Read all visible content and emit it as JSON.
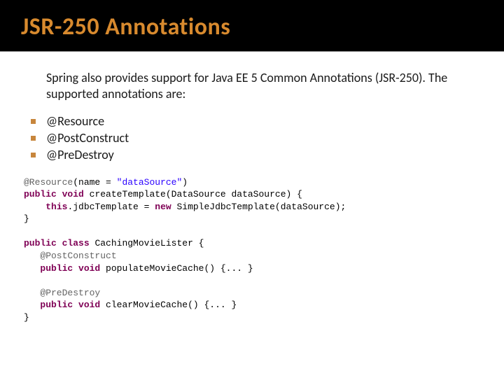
{
  "title": "JSR-250 Annotations",
  "intro": "Spring also provides support for Java EE 5 Common Annotations (JSR-250). The supported annotations are:",
  "bullets": [
    "@Resource",
    "@PostConstruct",
    "@PreDestroy"
  ],
  "code": {
    "t1": "@Resource",
    "t2": "(name = ",
    "t3": "\"dataSource\"",
    "t4": ")",
    "t5": "public",
    "t6": " ",
    "t7": "void",
    "t8": " createTemplate(DataSource dataSource) {",
    "t9": "    ",
    "t10": "this",
    "t11": ".jdbcTemplate = ",
    "t12": "new",
    "t13": " SimpleJdbcTemplate(dataSource);",
    "t14": "}",
    "t15": "public",
    "t16": " ",
    "t17": "class",
    "t18": " CachingMovieLister {",
    "t19": "   ",
    "t20": "@PostConstruct",
    "t21": "   ",
    "t22": "public",
    "t23": " ",
    "t24": "void",
    "t25": " populateMovieCache() {... }",
    "t26": "   ",
    "t27": "@PreDestroy",
    "t28": "   ",
    "t29": "public",
    "t30": " ",
    "t31": "void",
    "t32": " clearMovieCache() {... }",
    "t33": "}"
  }
}
